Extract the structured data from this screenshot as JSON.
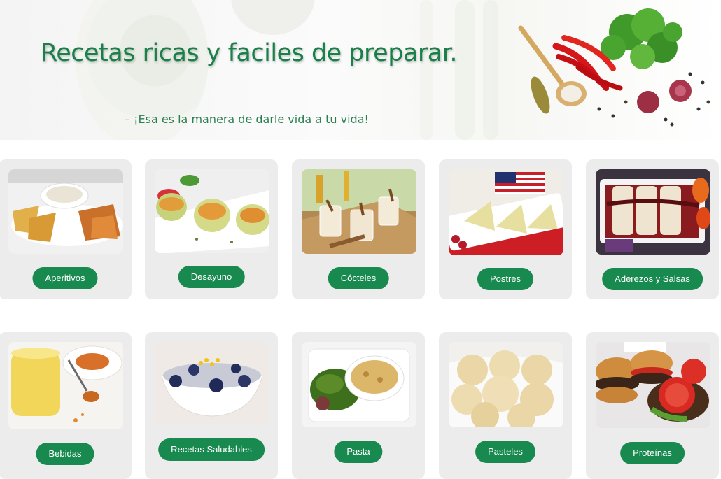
{
  "hero": {
    "title": "Recetas ricas y faciles de preparar.",
    "subtitle": "– ¡Esa es la manera de darle vida a tu vida!"
  },
  "categories": [
    {
      "label": "Aperitivos",
      "image": "chips-and-dip-icon"
    },
    {
      "label": "Desayuno",
      "image": "egg-muffins-icon"
    },
    {
      "label": "Cócteles",
      "image": "cocktail-glasses-icon"
    },
    {
      "label": "Postres",
      "image": "pie-slices-icon"
    },
    {
      "label": "Aderezos y Salsas",
      "image": "enchilada-tray-icon"
    },
    {
      "label": "Bebidas",
      "image": "golden-drink-icon"
    },
    {
      "label": "Recetas Saludables",
      "image": "berry-bowl-icon"
    },
    {
      "label": "Pasta",
      "image": "pasta-gratin-icon"
    },
    {
      "label": "Pasteles",
      "image": "muffins-icon"
    },
    {
      "label": "Proteínas",
      "image": "burgers-icon"
    }
  ],
  "colors": {
    "accent": "#198a4f",
    "title": "#198049",
    "card_bg": "#ececec"
  }
}
